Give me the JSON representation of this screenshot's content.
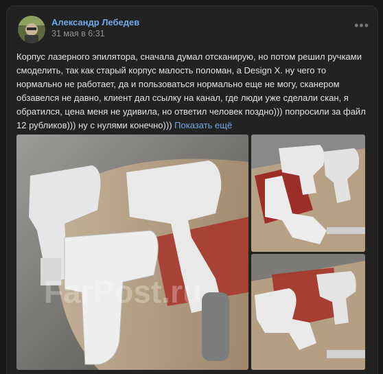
{
  "post": {
    "author": "Александр Лебедев",
    "date": "31 мая в 6:31",
    "menu_icon": "more-horizontal-icon",
    "text": "Корпус лазерного эпилятора, сначала думал отсканирую, но потом решил ручками смоделить, так как старый корпус малость поломан, а Design X. ну чего то нормально не работает, да и пользоваться нормально еще не могу, сканером обзавелся не давно, клиент дал ссылку на канал, где люди уже сделали скан, я обратился, цена меня не удивила, но ответил человек поздно))) попросили за файл 12 рубликов))) ну с нулями конечно))) ",
    "show_more": "Показать ещё",
    "watermark": "FarPost.ru"
  },
  "colors": {
    "background": "#19191a",
    "card": "#222222",
    "link": "#71aaeb",
    "text": "#e1e3e6",
    "meta": "#939393"
  }
}
